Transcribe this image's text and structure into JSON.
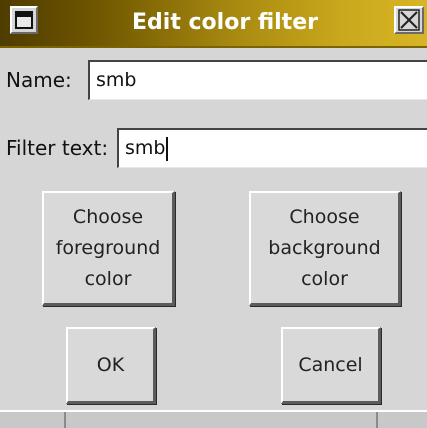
{
  "window": {
    "title": "Edit color filter",
    "menu_icon": "window-menu-icon",
    "close_icon": "close-icon"
  },
  "form": {
    "name_label": "Name:",
    "name_value": "smb",
    "filter_label": "Filter text:",
    "filter_value": "smb"
  },
  "buttons": {
    "foreground_label": "Choose\nforeground\ncolor",
    "background_label": "Choose\nbackground\ncolor",
    "ok_label": "OK",
    "cancel_label": "Cancel"
  },
  "colors": {
    "titlebar_dark": "#4f3c00",
    "titlebar_light": "#d8b526",
    "window_bg": "#d6d6d6"
  }
}
